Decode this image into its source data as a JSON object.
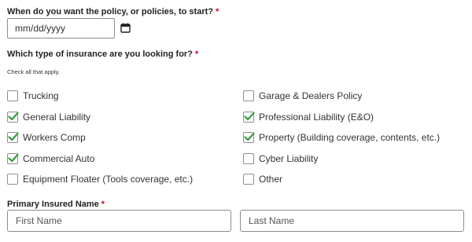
{
  "start_date": {
    "question": "When do you want the policy, or policies, to start?",
    "required_mark": "*",
    "placeholder": "mm/dd/yyyy",
    "icon": "calendar-icon"
  },
  "insurance_type": {
    "question": "Which type of insurance are you looking for?",
    "required_mark": "*",
    "hint": "Check all that apply.",
    "check_color": "#2e9d3a",
    "options_left": [
      {
        "label": "Trucking",
        "checked": false
      },
      {
        "label": "General Liability",
        "checked": true
      },
      {
        "label": "Workers Comp",
        "checked": true
      },
      {
        "label": "Commercial Auto",
        "checked": true
      },
      {
        "label": "Equipment Floater (Tools coverage, etc.)",
        "checked": false
      }
    ],
    "options_right": [
      {
        "label": "Garage & Dealers Policy",
        "checked": false
      },
      {
        "label": "Professional Liability (E&O)",
        "checked": true
      },
      {
        "label": "Property (Building coverage, contents, etc.)",
        "checked": true
      },
      {
        "label": "Cyber Liability",
        "checked": false
      },
      {
        "label": "Other",
        "checked": false
      }
    ]
  },
  "primary_insured": {
    "label": "Primary Insured Name",
    "required_mark": "*",
    "first_placeholder": "First Name",
    "last_placeholder": "Last Name"
  },
  "required_color": "#d0021b"
}
